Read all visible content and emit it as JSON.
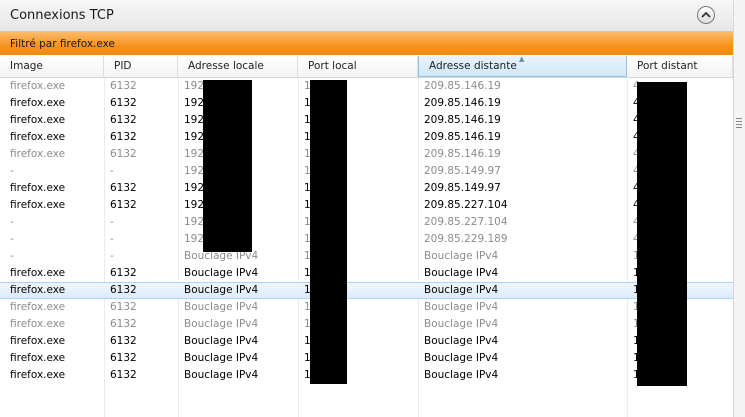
{
  "panel": {
    "title": "Connexions TCP",
    "collapse_icon": "chevron-up-icon"
  },
  "filter": {
    "label": "Filtré par firefox.exe",
    "accent": "#f7921e"
  },
  "columns": [
    "Image",
    "PID",
    "Adresse locale",
    "Port local",
    "Adresse distante",
    "Port distant"
  ],
  "sorted_column": "Adresse distante",
  "rows": [
    {
      "image": "firefox.exe",
      "pid": "6132",
      "local_addr": "192.",
      "local_port": "1",
      "remote_addr": "209.85.146.19",
      "remote_port": "4",
      "state": "dim"
    },
    {
      "image": "firefox.exe",
      "pid": "6132",
      "local_addr": "192.",
      "local_port": "1",
      "remote_addr": "209.85.146.19",
      "remote_port": "4",
      "state": "normal"
    },
    {
      "image": "firefox.exe",
      "pid": "6132",
      "local_addr": "192.",
      "local_port": "1",
      "remote_addr": "209.85.146.19",
      "remote_port": "4",
      "state": "normal"
    },
    {
      "image": "firefox.exe",
      "pid": "6132",
      "local_addr": "192.",
      "local_port": "1",
      "remote_addr": "209.85.146.19",
      "remote_port": "4",
      "state": "normal"
    },
    {
      "image": "firefox.exe",
      "pid": "6132",
      "local_addr": "192.",
      "local_port": "1",
      "remote_addr": "209.85.146.19",
      "remote_port": "4",
      "state": "dim"
    },
    {
      "image": "-",
      "pid": "-",
      "local_addr": "192.",
      "local_port": "1",
      "remote_addr": "209.85.149.97",
      "remote_port": "4",
      "state": "dim"
    },
    {
      "image": "firefox.exe",
      "pid": "6132",
      "local_addr": "192.",
      "local_port": "1",
      "remote_addr": "209.85.149.97",
      "remote_port": "4",
      "state": "normal"
    },
    {
      "image": "firefox.exe",
      "pid": "6132",
      "local_addr": "192.",
      "local_port": "1",
      "remote_addr": "209.85.227.104",
      "remote_port": "4",
      "state": "normal"
    },
    {
      "image": "-",
      "pid": "-",
      "local_addr": "192.",
      "local_port": "1",
      "remote_addr": "209.85.227.104",
      "remote_port": "4",
      "state": "dim"
    },
    {
      "image": "-",
      "pid": "-",
      "local_addr": "192.",
      "local_port": "1",
      "remote_addr": "209.85.229.189",
      "remote_port": "4",
      "state": "dim"
    },
    {
      "image": "-",
      "pid": "-",
      "local_addr": "Bouclage IPv4",
      "local_port": "1",
      "remote_addr": "Bouclage IPv4",
      "remote_port": "1",
      "state": "dim"
    },
    {
      "image": "firefox.exe",
      "pid": "6132",
      "local_addr": "Bouclage IPv4",
      "local_port": "1",
      "remote_addr": "Bouclage IPv4",
      "remote_port": "1",
      "state": "normal"
    },
    {
      "image": "firefox.exe",
      "pid": "6132",
      "local_addr": "Bouclage IPv4",
      "local_port": "1",
      "remote_addr": "Bouclage IPv4",
      "remote_port": "1",
      "state": "selected"
    },
    {
      "image": "firefox.exe",
      "pid": "6132",
      "local_addr": "Bouclage IPv4",
      "local_port": "1",
      "remote_addr": "Bouclage IPv4",
      "remote_port": "1",
      "state": "dim"
    },
    {
      "image": "firefox.exe",
      "pid": "6132",
      "local_addr": "Bouclage IPv4",
      "local_port": "1",
      "remote_addr": "Bouclage IPv4",
      "remote_port": "1",
      "state": "dim"
    },
    {
      "image": "firefox.exe",
      "pid": "6132",
      "local_addr": "Bouclage IPv4",
      "local_port": "1",
      "remote_addr": "Bouclage IPv4",
      "remote_port": "1",
      "state": "normal"
    },
    {
      "image": "firefox.exe",
      "pid": "6132",
      "local_addr": "Bouclage IPv4",
      "local_port": "1",
      "remote_addr": "Bouclage IPv4",
      "remote_port": "1",
      "state": "normal"
    },
    {
      "image": "firefox.exe",
      "pid": "6132",
      "local_addr": "Bouclage IPv4",
      "local_port": "1",
      "remote_addr": "Bouclage IPv4",
      "remote_port": "1",
      "state": "normal"
    }
  ]
}
